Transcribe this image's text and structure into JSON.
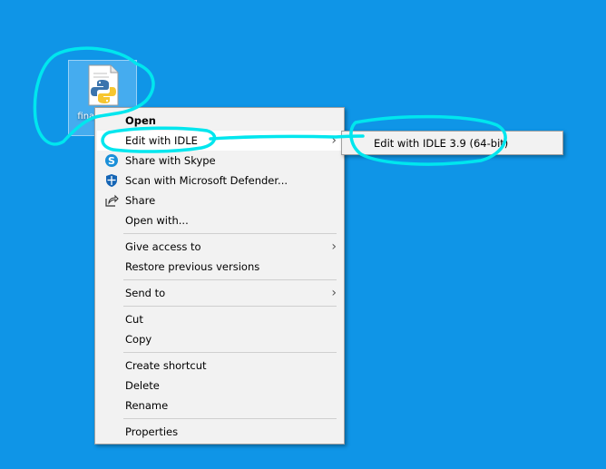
{
  "desktop": {
    "file": {
      "label": "finan… la…"
    }
  },
  "context_menu": {
    "items": [
      {
        "label": "Open"
      },
      {
        "label": "Edit with IDLE"
      },
      {
        "label": "Share with Skype"
      },
      {
        "label": "Scan with Microsoft Defender..."
      },
      {
        "label": "Share"
      },
      {
        "label": "Open with..."
      },
      {
        "label": "Give access to"
      },
      {
        "label": "Restore previous versions"
      },
      {
        "label": "Send to"
      },
      {
        "label": "Cut"
      },
      {
        "label": "Copy"
      },
      {
        "label": "Create shortcut"
      },
      {
        "label": "Delete"
      },
      {
        "label": "Rename"
      },
      {
        "label": "Properties"
      }
    ]
  },
  "submenu": {
    "items": [
      {
        "label": "Edit with IDLE 3.9 (64-bit)"
      }
    ]
  },
  "colors": {
    "desktop": "#0f95e7",
    "annotation": "#00e0ee",
    "menu_bg": "#f2f2f2",
    "python_blue": "#3b74ad",
    "python_yellow": "#f7c62f"
  },
  "icons": [
    "python-file-icon",
    "skype-icon",
    "defender-shield-icon",
    "share-icon",
    "chevron-right-icon"
  ]
}
